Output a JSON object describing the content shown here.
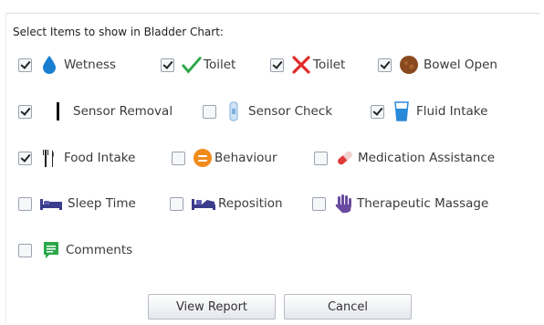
{
  "heading": "Select Items to show in Bladder Chart:",
  "items": [
    {
      "label": "Wetness",
      "checked": true,
      "icon": "water-drop-icon"
    },
    {
      "label": "Toilet",
      "checked": true,
      "icon": "green-check-icon"
    },
    {
      "label": "Toilet",
      "checked": true,
      "icon": "red-cross-icon"
    },
    {
      "label": "Bowel Open",
      "checked": true,
      "icon": "brown-circle-icon"
    },
    {
      "label": "Sensor Removal",
      "checked": true,
      "icon": "vertical-bar-icon"
    },
    {
      "label": "Sensor Check",
      "checked": false,
      "icon": "sensor-icon"
    },
    {
      "label": "Fluid Intake",
      "checked": true,
      "icon": "glass-icon"
    },
    {
      "label": "Food Intake",
      "checked": true,
      "icon": "cutlery-icon"
    },
    {
      "label": "Behaviour",
      "checked": false,
      "icon": "orange-face-icon"
    },
    {
      "label": "Medication Assistance",
      "checked": false,
      "icon": "pill-icon"
    },
    {
      "label": "Sleep Time",
      "checked": false,
      "icon": "bed-icon"
    },
    {
      "label": "Reposition",
      "checked": false,
      "icon": "reposition-bed-icon"
    },
    {
      "label": "Therapeutic Massage",
      "checked": false,
      "icon": "hand-icon"
    },
    {
      "label": "Comments",
      "checked": false,
      "icon": "comment-icon"
    }
  ],
  "buttons": {
    "view_report": "View Report",
    "cancel": "Cancel"
  },
  "colors": {
    "drop": "#1a7fd1",
    "check": "#2ea84a",
    "cross": "#e02a2a",
    "bowel": "#8a4a1f",
    "orange": "#f28a1a",
    "pill": "#e03a3a",
    "bed": "#3a3d8c",
    "hand": "#6a4aa0",
    "comment": "#2aa84a",
    "glass": "#2a8ad8"
  }
}
